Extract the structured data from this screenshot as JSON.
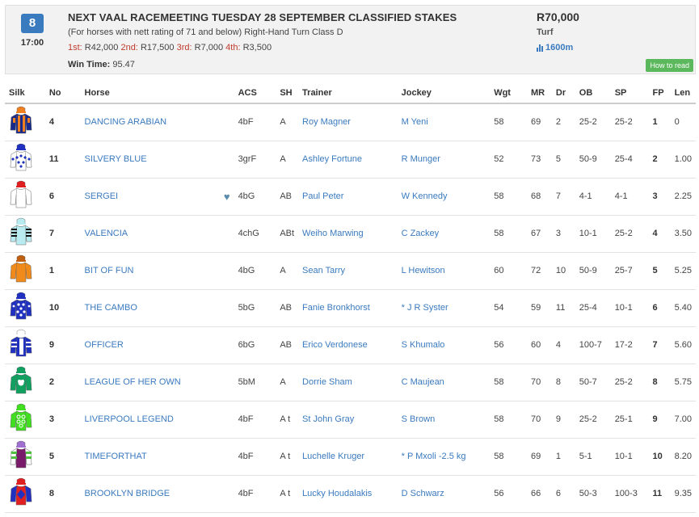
{
  "race": {
    "number": "8",
    "time": "17:00",
    "title": "NEXT VAAL RACEMEETING TUESDAY 28 SEPTEMBER CLASSIFIED STAKES",
    "description": "(For horses with nett rating of 71 and below) Right-Hand Turn Class D",
    "prizes": [
      {
        "place": "1st:",
        "amount": "R42,000"
      },
      {
        "place": "2nd:",
        "amount": "R17,500"
      },
      {
        "place": "3rd:",
        "amount": "R7,000"
      },
      {
        "place": "4th:",
        "amount": "R3,500"
      }
    ],
    "win_time_label": "Win Time:",
    "win_time": "95.47",
    "stake": "R70,000",
    "surface": "Turf",
    "distance": "1600m",
    "howto_label": "How to read"
  },
  "columns": [
    "Silk",
    "No",
    "Horse",
    "ACS",
    "SH",
    "Trainer",
    "Jockey",
    "Wgt",
    "MR",
    "Dr",
    "OB",
    "SP",
    "FP",
    "Len"
  ],
  "runners": [
    {
      "no": "4",
      "horse": "DANCING ARABIAN",
      "acs": "4bF",
      "sh": "A",
      "trainer": "Roy Magner",
      "jockey": "M Yeni",
      "wgt": "58",
      "mr": "69",
      "dr": "2",
      "ob": "25-2",
      "sp": "25-2",
      "fp": "1",
      "len": "0",
      "silk": {
        "body": "#1a2a8a",
        "stripe": "#f08020",
        "sleeve": "#1a2a8a",
        "cap": "#f08020",
        "pattern": "stripes"
      }
    },
    {
      "no": "11",
      "horse": "SILVERY BLUE",
      "acs": "3grF",
      "sh": "A",
      "trainer": "Ashley Fortune",
      "jockey": "R Munger",
      "wgt": "52",
      "mr": "73",
      "dr": "5",
      "ob": "50-9",
      "sp": "25-4",
      "fp": "2",
      "len": "1.00",
      "silk": {
        "body": "#ffffff",
        "stripe": "#2030c0",
        "sleeve": "#ffffff",
        "cap": "#2030c0",
        "pattern": "diamonds"
      }
    },
    {
      "no": "6",
      "horse": "SERGEI",
      "acs": "4bG",
      "sh": "AB",
      "trainer": "Paul Peter",
      "jockey": "W Kennedy",
      "wgt": "58",
      "mr": "68",
      "dr": "7",
      "ob": "4-1",
      "sp": "4-1",
      "fp": "3",
      "len": "2.25",
      "favourite": true,
      "silk": {
        "body": "#ffffff",
        "stripe": "#e02020",
        "sleeve": "#ffffff",
        "cap": "#e02020",
        "pattern": "plain"
      }
    },
    {
      "no": "7",
      "horse": "VALENCIA",
      "acs": "4chG",
      "sh": "ABt",
      "trainer": "Weiho Marwing",
      "jockey": "C Zackey",
      "wgt": "58",
      "mr": "67",
      "dr": "3",
      "ob": "10-1",
      "sp": "25-2",
      "fp": "4",
      "len": "3.50",
      "silk": {
        "body": "#b8ecf0",
        "stripe": "#111111",
        "sleeve": "#b8ecf0",
        "cap": "#b8ecf0",
        "pattern": "sleeve-stripes"
      }
    },
    {
      "no": "1",
      "horse": "BIT OF FUN",
      "acs": "4bG",
      "sh": "A",
      "trainer": "Sean Tarry",
      "jockey": "L Hewitson",
      "wgt": "60",
      "mr": "72",
      "dr": "10",
      "ob": "50-9",
      "sp": "25-7",
      "fp": "5",
      "len": "5.25",
      "silk": {
        "body": "#f08a1a",
        "stripe": "#f08a1a",
        "sleeve": "#f08a1a",
        "cap": "#c06010",
        "pattern": "plain"
      }
    },
    {
      "no": "10",
      "horse": "THE CAMBO",
      "acs": "5bG",
      "sh": "AB",
      "trainer": "Fanie Bronkhorst",
      "jockey": "* J R Syster",
      "wgt": "54",
      "mr": "59",
      "dr": "11",
      "ob": "25-4",
      "sp": "10-1",
      "fp": "6",
      "len": "5.40",
      "silk": {
        "body": "#2030c0",
        "stripe": "#ffffff",
        "sleeve": "#2030c0",
        "cap": "#2030c0",
        "pattern": "spots"
      }
    },
    {
      "no": "9",
      "horse": "OFFICER",
      "acs": "6bG",
      "sh": "AB",
      "trainer": "Erico Verdonese",
      "jockey": "S Khumalo",
      "wgt": "56",
      "mr": "60",
      "dr": "4",
      "ob": "100-7",
      "sp": "17-2",
      "fp": "7",
      "len": "5.60",
      "silk": {
        "body": "#2030c0",
        "stripe": "#ffffff",
        "sleeve": "#2030c0",
        "cap": "#ffffff",
        "pattern": "vstripes"
      }
    },
    {
      "no": "2",
      "horse": "LEAGUE OF HER OWN",
      "acs": "5bM",
      "sh": "A",
      "trainer": "Dorrie Sham",
      "jockey": "C Maujean",
      "wgt": "58",
      "mr": "70",
      "dr": "8",
      "ob": "50-7",
      "sp": "25-2",
      "fp": "8",
      "len": "5.75",
      "silk": {
        "body": "#10a060",
        "stripe": "#ffffff",
        "sleeve": "#10a060",
        "cap": "#10a060",
        "pattern": "emblem"
      }
    },
    {
      "no": "3",
      "horse": "LIVERPOOL LEGEND",
      "acs": "4bF",
      "sh": "A t",
      "trainer": "St John Gray",
      "jockey": "S Brown",
      "wgt": "58",
      "mr": "70",
      "dr": "9",
      "ob": "25-2",
      "sp": "25-1",
      "fp": "9",
      "len": "7.00",
      "silk": {
        "body": "#40e020",
        "stripe": "#ffffff",
        "sleeve": "#40e020",
        "cap": "#40e020",
        "pattern": "rings"
      }
    },
    {
      "no": "5",
      "horse": "TIMEFORTHAT",
      "acs": "4bF",
      "sh": "A t",
      "trainer": "Luchelle Kruger",
      "jockey": "* P Mxoli -2.5 kg",
      "wgt": "58",
      "mr": "69",
      "dr": "1",
      "ob": "5-1",
      "sp": "10-1",
      "fp": "10",
      "len": "8.20",
      "silk": {
        "body": "#7a1a6a",
        "stripe": "#50c040",
        "sleeve": "#ffffff",
        "cap": "#a070d0",
        "pattern": "sleeve-green"
      }
    },
    {
      "no": "8",
      "horse": "BROOKLYN BRIDGE",
      "acs": "4bF",
      "sh": "A t",
      "trainer": "Lucky Houdalakis",
      "jockey": "D Schwarz",
      "wgt": "56",
      "mr": "66",
      "dr": "6",
      "ob": "50-3",
      "sp": "100-3",
      "fp": "11",
      "len": "9.35",
      "silk": {
        "body": "#e02020",
        "stripe": "#2030c0",
        "sleeve": "#2030c0",
        "cap": "#e02020",
        "pattern": "diamond-center"
      }
    }
  ]
}
